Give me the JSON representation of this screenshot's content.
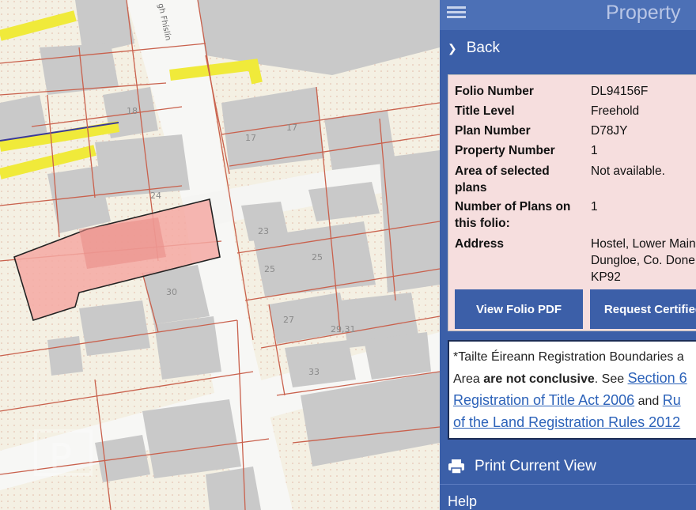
{
  "panel": {
    "title": "Property",
    "back_label": "Back",
    "fields": [
      {
        "key": "Folio Number",
        "value": "DL94156F"
      },
      {
        "key": "Title Level",
        "value": "Freehold"
      },
      {
        "key": "Plan Number",
        "value": "D78JY"
      },
      {
        "key": "Property Number",
        "value": "1"
      },
      {
        "key": "Area of selected plans",
        "value": "Not available."
      },
      {
        "key": "Number of Plans on this folio:",
        "value": "1"
      },
      {
        "key": "Address",
        "value": "Hostel, Lower Main\nDungloe, Co. Done\nKP92"
      }
    ],
    "buttons": {
      "view_pdf": "View Folio PDF",
      "request_certified": "Request Certified"
    },
    "notice": {
      "text1": "*Tailte Éireann Registration Boundaries a",
      "text2_pre": "Area ",
      "text2_bold": "are not conclusive",
      "text2_post": ". See ",
      "link1": "Section 6",
      "link2": "Registration of Title Act 2006",
      "and": " and ",
      "link3": "Ru",
      "link4": "of the Land Registration Rules 2012"
    },
    "print_label": "Print Current View",
    "help_label": "Help"
  },
  "map": {
    "street_name": "gh Fhíslín",
    "plot_numbers": [
      "18",
      "17",
      "17",
      "24",
      "23",
      "25",
      "25",
      "30",
      "27",
      "29,31",
      "33"
    ],
    "watermark": "P"
  },
  "colors": {
    "panel_bg": "#3b5fa8",
    "header_bg": "#4c70b6",
    "info_bg": "#f6dede",
    "highlight_parcel": "#f4a9a3",
    "boundary": "#c9614d",
    "road_yellow": "#f0ea3a",
    "building": "#c9c9c9"
  },
  "icons": {
    "menu": "hamburger-icon",
    "back": "chevron-right-icon",
    "print": "printer-icon"
  }
}
